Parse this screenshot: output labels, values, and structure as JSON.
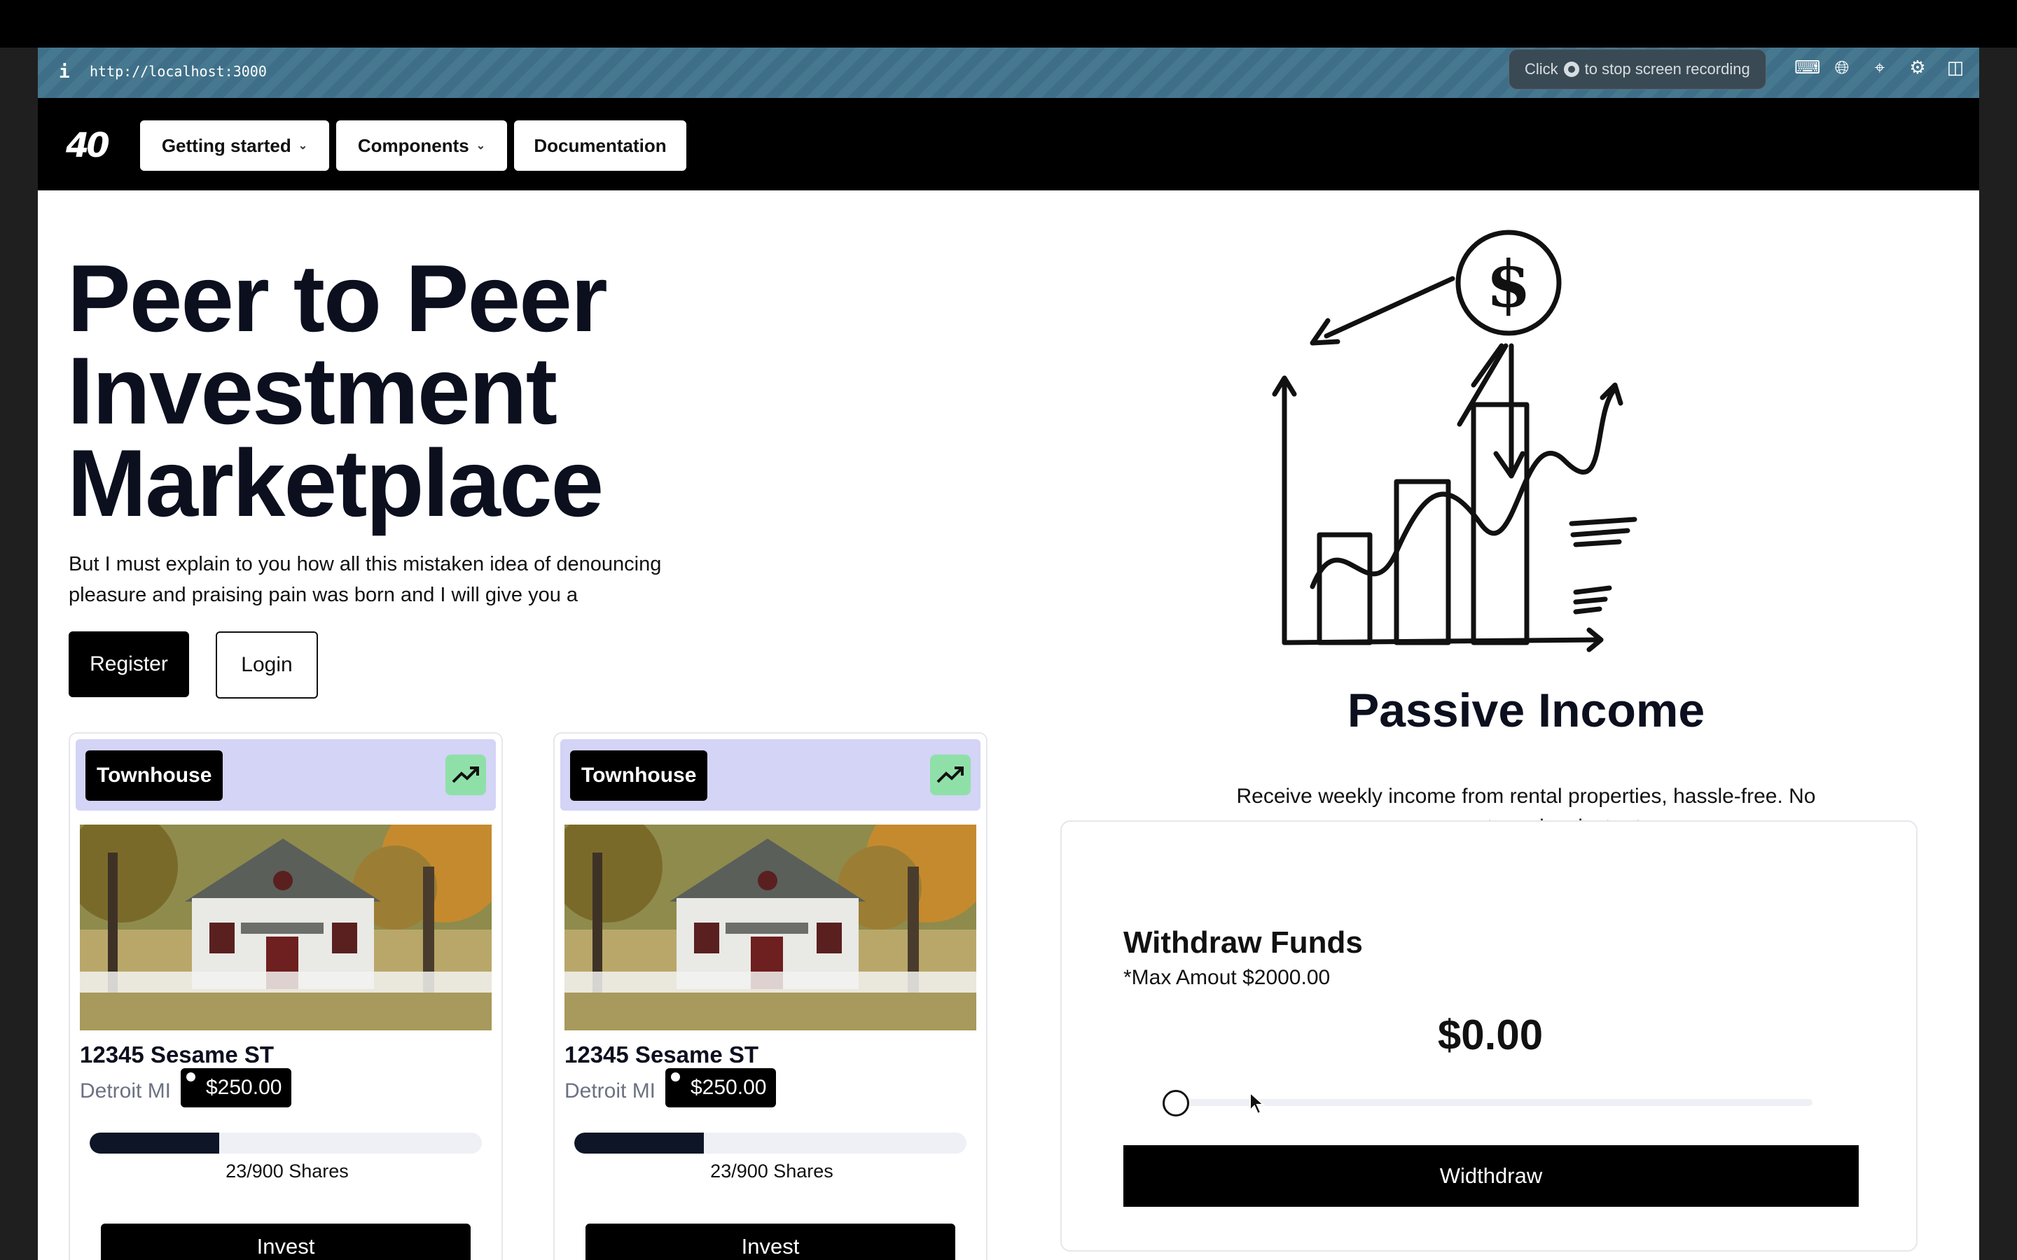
{
  "browser": {
    "info_icon": "i",
    "url": "http://localhost:3000",
    "recording_tip_prefix": "Click",
    "recording_tip_suffix": "to stop screen recording",
    "toolbar_icons": [
      "terminal-icon",
      "globe-icon",
      "crosshair-icon",
      "extension-icon",
      "sidebar-icon"
    ]
  },
  "nav": {
    "logo": "40",
    "items": [
      {
        "label": "Getting started",
        "has_dropdown": true
      },
      {
        "label": "Components",
        "has_dropdown": true
      },
      {
        "label": "Documentation",
        "has_dropdown": false
      }
    ]
  },
  "hero": {
    "title_line1": "Peer to Peer",
    "title_line2": "Investment",
    "title_line3": "Marketplace",
    "subtitle_line1": "But I must explain to you how all this mistaken idea of denouncing",
    "subtitle_line2": "pleasure and praising pain was born and I will give you a",
    "register_label": "Register",
    "login_label": "Login"
  },
  "properties": [
    {
      "type": "Townhouse",
      "address": "12345 Sesame ST",
      "city": "Detroit MI",
      "price": "$250.00",
      "shares_text": "23/900 Shares",
      "progress": 0.33,
      "invest_label": "Invest"
    },
    {
      "type": "Townhouse",
      "address": "12345 Sesame ST",
      "city": "Detroit MI",
      "price": "$250.00",
      "shares_text": "23/900 Shares",
      "progress": 0.33,
      "invest_label": "Invest"
    }
  ],
  "passive": {
    "title": "Passive Income",
    "subtitle_line1": "Receive weekly income from rental properties, hassle-free. No",
    "subtitle_line2": "management worries, just returns"
  },
  "withdraw": {
    "title": "Withdraw Funds",
    "max_text": "*Max Amout $2000.00",
    "amount": "$0.00",
    "slider_value": 0,
    "button_label": "Widthdraw"
  },
  "colors": {
    "accent": "#000000",
    "card_header": "#d3d4f6",
    "trend_badge": "#8fe0a8",
    "progress_fill": "#0e1527"
  }
}
